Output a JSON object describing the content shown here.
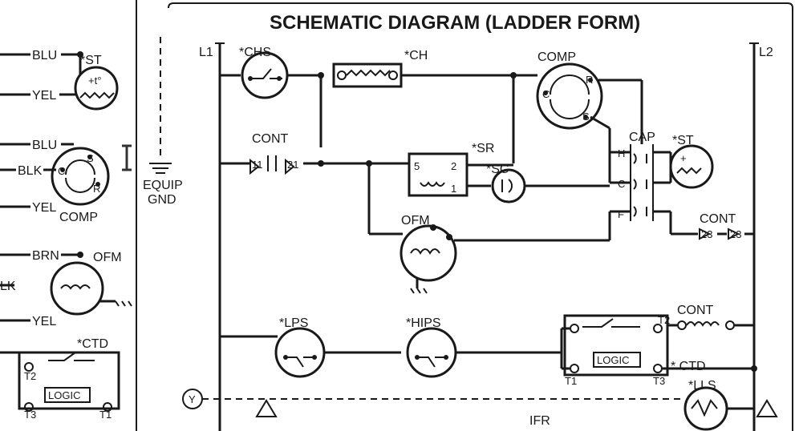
{
  "title": "SCHEMATIC DIAGRAM  (LADDER FORM)",
  "left_panel": {
    "wires": [
      "BLU",
      "YEL",
      "BLU",
      "BLK",
      "YEL",
      "BRN",
      "LK",
      "YEL"
    ],
    "components": {
      "st": "*ST",
      "comp": "COMP",
      "ofm": "OFM",
      "ctd": "*CTD",
      "logic": "LOGIC",
      "comp_terminals": [
        "C",
        "S",
        "R"
      ],
      "ctd_terminals": [
        "T2",
        "T3",
        "T1"
      ]
    }
  },
  "main": {
    "rails": {
      "l1": "L1",
      "l2": "L2"
    },
    "equip_gnd": "EQUIP\nGND",
    "components": {
      "chs": "*CHS",
      "ch": "*CH",
      "cont_left": "CONT",
      "cont_left_terms": [
        "11",
        "21"
      ],
      "comp": "COMP",
      "comp_terms": [
        "C",
        "S",
        "R"
      ],
      "sr": "*SR",
      "sr_terms": [
        "5",
        "2",
        "1"
      ],
      "sc": "*SC",
      "cap": "CAP",
      "cap_terms": [
        "H",
        "C",
        "F"
      ],
      "st": "*ST",
      "cont_right": "CONT",
      "cont_right_terms": [
        "23",
        "23"
      ],
      "ofm": "OFM",
      "lps": "*LPS",
      "hips": "*HIPS",
      "logic_box": "LOGIC",
      "logic_terms": [
        "T2",
        "T1",
        "T3"
      ],
      "cont_top_right": "CONT",
      "ctd": "* CTD",
      "lls": "*LLS",
      "ifr": "IFR",
      "y": "Y"
    }
  }
}
